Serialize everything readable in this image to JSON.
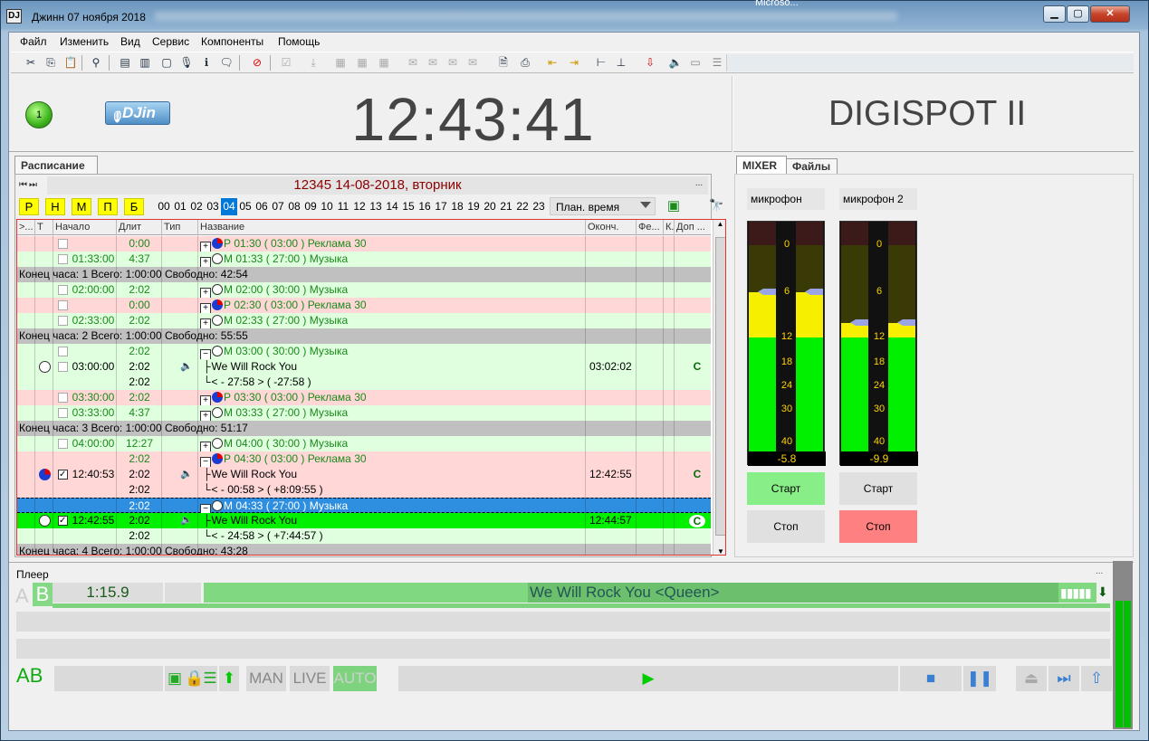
{
  "window": {
    "title": "Джинн 07 ноября 2018",
    "other_window": "Microso..."
  },
  "menu": [
    "Файл",
    "Изменить",
    "Вид",
    "Сервис",
    "Компоненты",
    "Помощь"
  ],
  "header": {
    "led": "1",
    "logo": "DJin",
    "clock": "12:43:41",
    "brand": "DIGISPOT II"
  },
  "tabs": {
    "schedule": "Расписание",
    "mixer": "MIXER",
    "files": "Файлы"
  },
  "schedule": {
    "date_title": "12345 14-08-2018, вторник",
    "more": "...",
    "day_buttons": [
      "Р",
      "Н",
      "М",
      "П",
      "Б"
    ],
    "hours": [
      "00",
      "01",
      "02",
      "03",
      "04",
      "05",
      "06",
      "07",
      "08",
      "09",
      "10",
      "11",
      "12",
      "13",
      "14",
      "15",
      "16",
      "17",
      "18",
      "19",
      "20",
      "21",
      "22",
      "23"
    ],
    "selected_hour": "04",
    "plan_select": "План. время",
    "columns": [
      ">...",
      "Т",
      "Начало",
      "Длит",
      "Тип",
      "Название",
      "Оконч.",
      "Фе...",
      "К.",
      "Доп ..."
    ],
    "rows": [
      {
        "cls": "pink",
        "start": "",
        "chk": false,
        "dur": "0:00",
        "icon": "pie",
        "tree": "plus",
        "name": "Р 01:30 ( 03:00 ) Реклама 30"
      },
      {
        "cls": "green",
        "start": "01:33:00",
        "chk": false,
        "dur": "4:37",
        "icon": "clk",
        "tree": "plus",
        "name": "М 01:33 ( 27:00 ) Музыка"
      },
      {
        "cls": "gray",
        "summary": "Конец часа: 1 Всего: 1:00:00 Свободно: 42:54"
      },
      {
        "cls": "green",
        "start": "02:00:00",
        "chk": false,
        "dur": "2:02",
        "icon": "clk",
        "tree": "plus",
        "name": "М 02:00 ( 30:00 ) Музыка"
      },
      {
        "cls": "pink",
        "start": "",
        "chk": false,
        "dur": "0:00",
        "icon": "pie",
        "tree": "plus",
        "name": "Р 02:30 ( 03:00 ) Реклама 30"
      },
      {
        "cls": "green",
        "start": "02:33:00",
        "chk": false,
        "dur": "2:02",
        "icon": "clk",
        "tree": "plus",
        "name": "М 02:33 ( 27:00 ) Музыка"
      },
      {
        "cls": "gray",
        "summary": "Конец часа: 2 Всего: 1:00:00 Свободно: 55:55"
      },
      {
        "cls": "green",
        "start": "",
        "chk": false,
        "dur": "2:02",
        "icon": "clk",
        "tree": "minus",
        "name": "М 03:00 ( 30:00 ) Музыка"
      },
      {
        "cls": "green",
        "t": "clk",
        "start": "03:00:00",
        "chk": false,
        "dur": "2:02",
        "type": "spk",
        "tree": "child",
        "name": "We Will Rock You",
        "end": "03:02:02",
        "dop": "C",
        "dark": true
      },
      {
        "cls": "green",
        "start": "",
        "dur": "2:02",
        "tree": "last",
        "name": "< - 27:58 > ( -27:58 )",
        "dark": true
      },
      {
        "cls": "pink",
        "start": "03:30:00",
        "chk": false,
        "dur": "2:02",
        "icon": "pie",
        "tree": "plus",
        "name": "Р 03:30 ( 03:00 ) Реклама 30"
      },
      {
        "cls": "green",
        "start": "03:33:00",
        "chk": false,
        "dur": "4:37",
        "icon": "clk",
        "tree": "plus",
        "name": "М 03:33 ( 27:00 ) Музыка"
      },
      {
        "cls": "gray",
        "summary": "Конец часа: 3 Всего: 1:00:00 Свободно: 51:17"
      },
      {
        "cls": "green",
        "start": "04:00:00",
        "chk": false,
        "dur": "12:27",
        "icon": "clk",
        "tree": "plus",
        "name": "М 04:00 ( 30:00 ) Музыка"
      },
      {
        "cls": "pink",
        "start": "",
        "dur": "2:02",
        "icon": "pie",
        "tree": "minus",
        "name": "Р 04:30 ( 03:00 ) Реклама 30"
      },
      {
        "cls": "pink",
        "t": "pie",
        "start": "12:40:53",
        "chk": true,
        "dur": "2:02",
        "type": "spk",
        "tree": "child",
        "name": "We Will Rock You",
        "end": "12:42:55",
        "dop": "C",
        "dark": true
      },
      {
        "cls": "pink",
        "start": "",
        "dur": "2:02",
        "tree": "last",
        "name": "< - 00:58 > ( +8:09:55 )",
        "dark": true
      },
      {
        "cls": "blue",
        "start": "",
        "dur": "2:02",
        "icon": "clk",
        "tree": "minus",
        "name": "М 04:33 ( 27:00 ) Музыка"
      },
      {
        "cls": "lime",
        "t": "clk",
        "start": "12:42:55",
        "chk": true,
        "dur": "2:02",
        "type": "spk",
        "tree": "child",
        "name": "We Will Rock You",
        "end": "12:44:57",
        "dop": "C",
        "dark": true
      },
      {
        "cls": "green",
        "start": "",
        "dur": "2:02",
        "tree": "last",
        "name": "< - 24:58 > ( +7:44:57 )",
        "dark": true
      },
      {
        "cls": "gray",
        "summary": "Конец часа: 4 Всего: 1:00:00 Свободно: 43:28"
      }
    ]
  },
  "mixer": {
    "channels": [
      {
        "label": "микрофон",
        "value": "-5.8",
        "level_db": -5.8,
        "start": "Старт",
        "stop": "Стоп",
        "active": "start"
      },
      {
        "label": "микрофон 2",
        "value": "-9.9",
        "level_db": -9.9,
        "start": "Старт",
        "stop": "Стоп",
        "active": "stop"
      }
    ],
    "scale": [
      "0",
      "6",
      "12",
      "18",
      "24",
      "30",
      "40"
    ]
  },
  "player": {
    "label": "Плеер",
    "more": "...",
    "a": "A",
    "b": "B",
    "position": "1:15.9",
    "track": "We Will Rock You <Queen>",
    "modes": [
      "MAN",
      "LIVE",
      "AUTO"
    ],
    "active_mode": "AUTO"
  },
  "colors": {
    "pink_row": "#ffd7d7",
    "green_row": "#dfffdf",
    "selected_row": "#2e8fe0",
    "playing_row": "#00f000",
    "accent_green": "#1a8a1a"
  }
}
